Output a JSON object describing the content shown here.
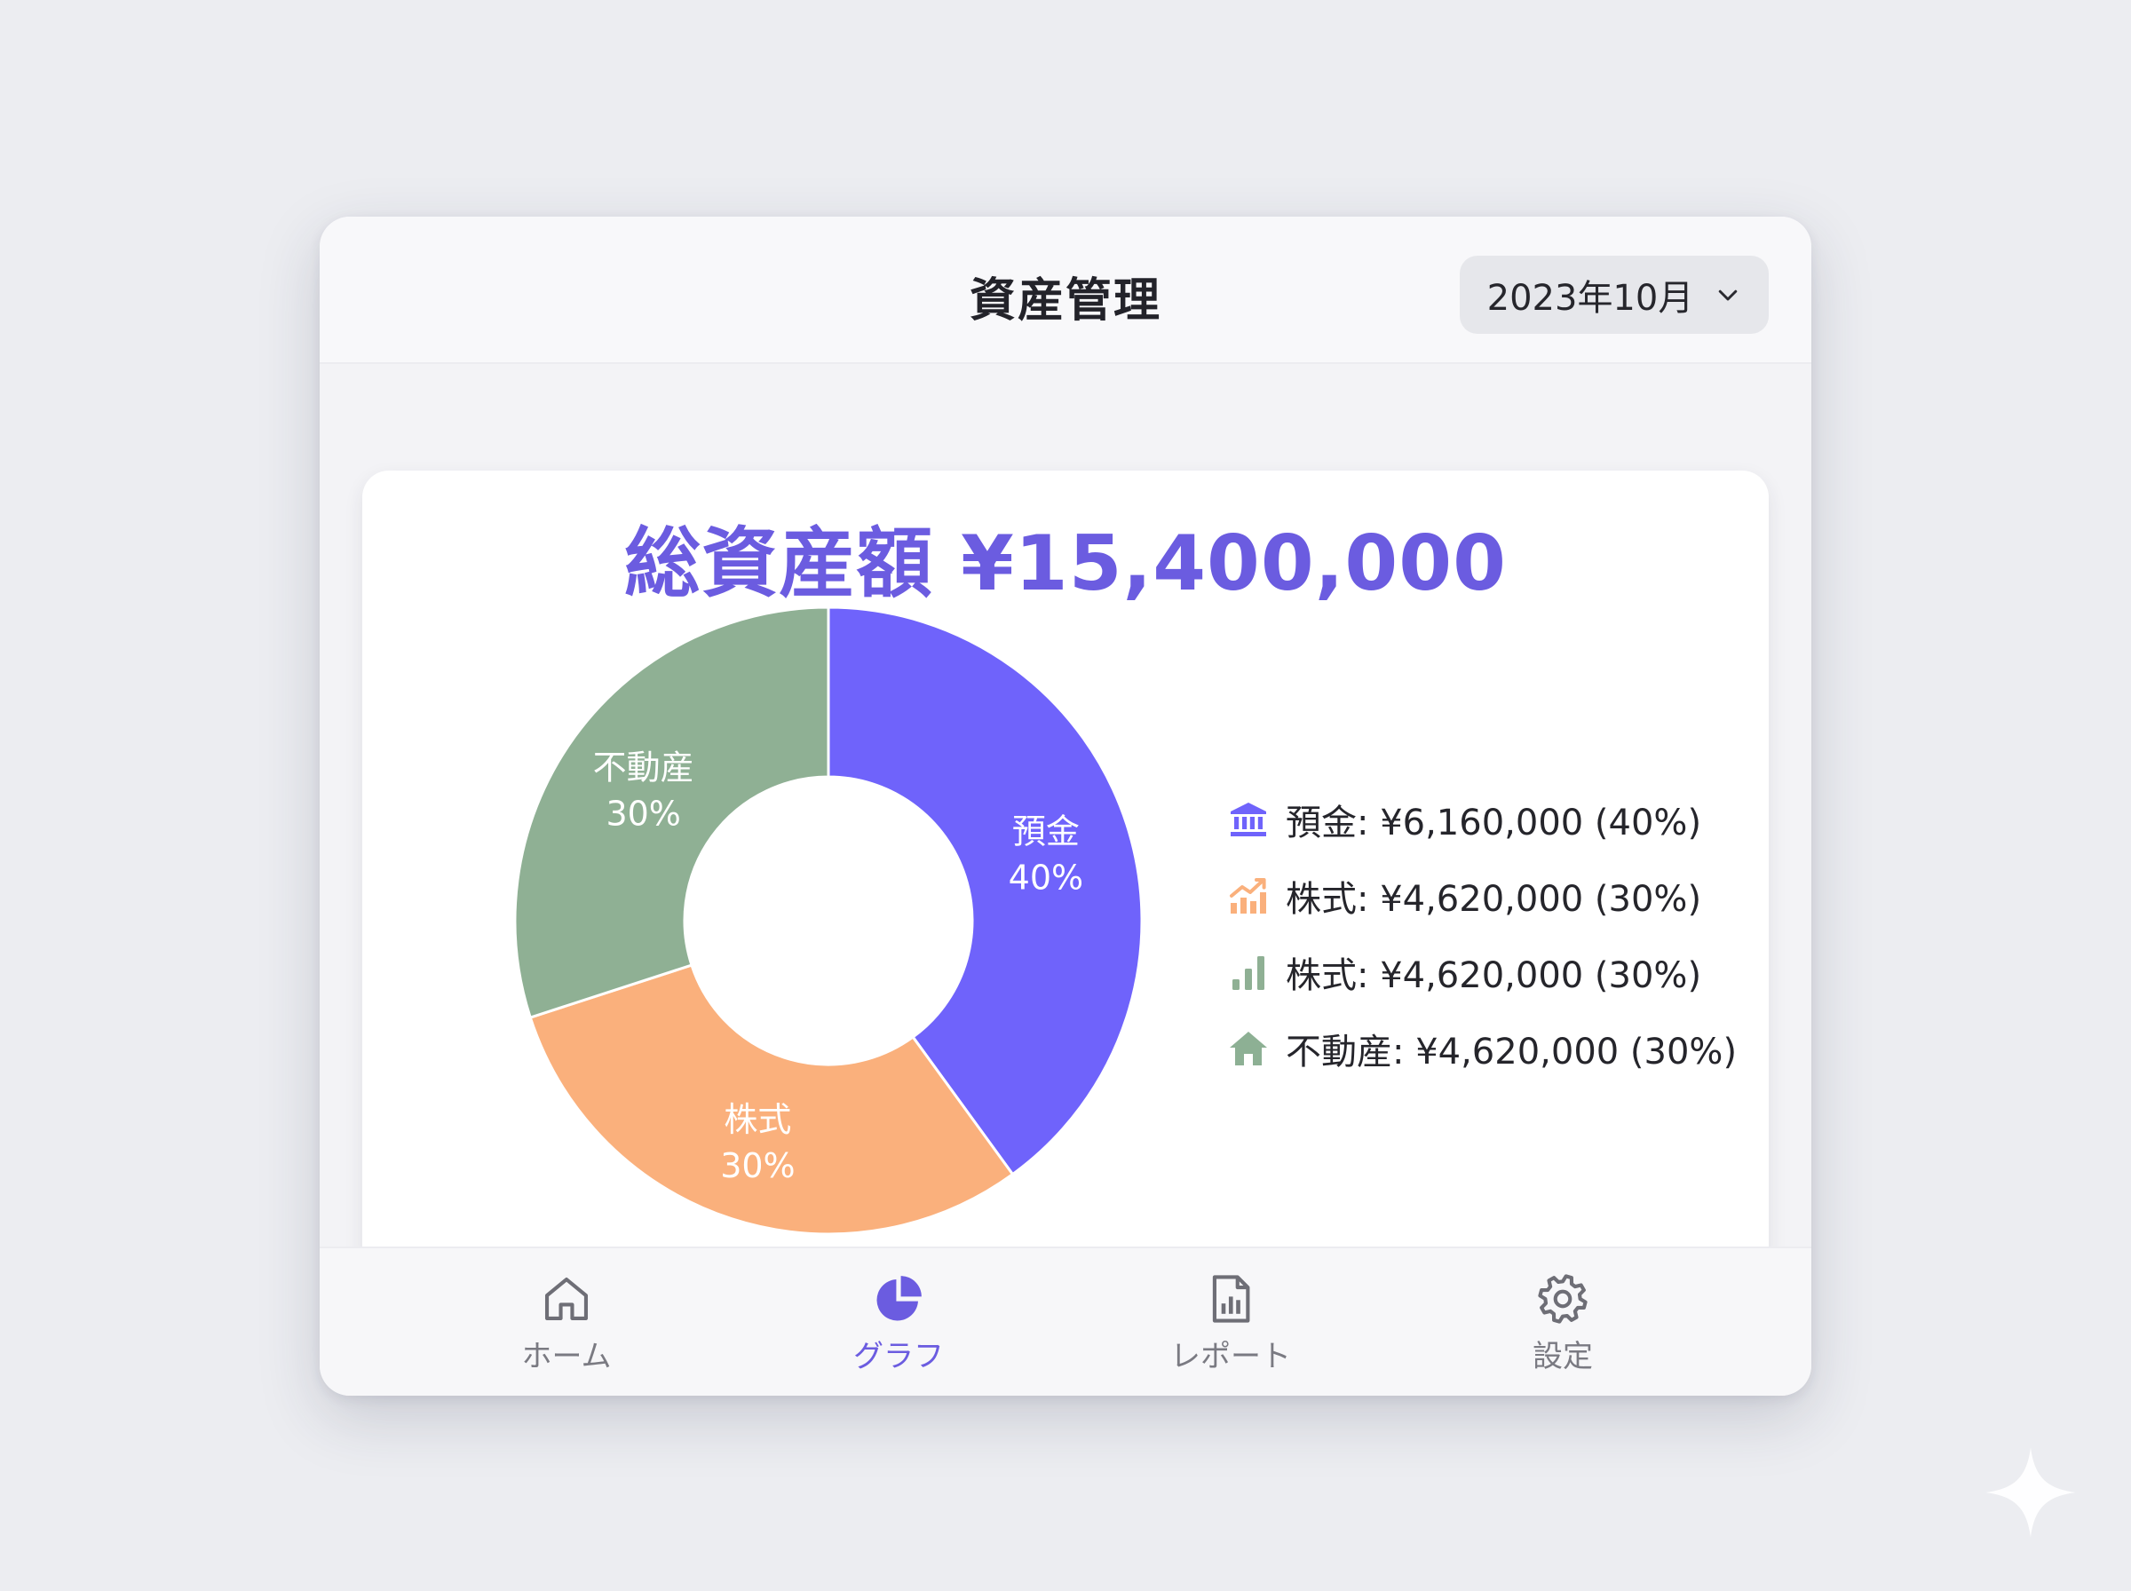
{
  "header": {
    "title": "資産管理",
    "month_selector": "2023年10月"
  },
  "summary": {
    "total_text": "総資産額 ¥15,400,000"
  },
  "colors": {
    "accent": "#6b5ce0",
    "deposit": "#6f63fb",
    "stocks": "#fab07c",
    "bars": "#8fb094",
    "real_estate": "#8db094"
  },
  "chart_data": {
    "type": "pie",
    "donut": true,
    "title": "",
    "slices": [
      {
        "label": "預金",
        "percent_label": "40%",
        "value": 6160000,
        "percent": 40,
        "color": "#6f63fb"
      },
      {
        "label": "株式",
        "percent_label": "30%",
        "value": 4620000,
        "percent": 30,
        "color": "#fab07c"
      },
      {
        "label": "不動産",
        "percent_label": "30%",
        "value": 4620000,
        "percent": 30,
        "color": "#8fb094"
      }
    ],
    "legend_placement": "right"
  },
  "legend": {
    "items": [
      {
        "text": "預金: ¥6,160,000 (40%)",
        "icon": "bank-icon",
        "color": "#6f63fb"
      },
      {
        "text": "株式: ¥4,620,000 (30%)",
        "icon": "trend-up-icon",
        "color": "#fab07c"
      },
      {
        "text": "株式: ¥4,620,000 (30%)",
        "icon": "bar-chart-icon",
        "color": "#8fb094"
      },
      {
        "text": "不動産: ¥4,620,000 (30%)",
        "icon": "house-icon",
        "color": "#8fb094"
      }
    ]
  },
  "nav": {
    "items": [
      {
        "label": "ホーム",
        "icon": "home-icon",
        "active": false
      },
      {
        "label": "グラフ",
        "icon": "pie-chart-icon",
        "active": true
      },
      {
        "label": "レポート",
        "icon": "report-icon",
        "active": false
      },
      {
        "label": "設定",
        "icon": "gear-icon",
        "active": false
      }
    ]
  }
}
